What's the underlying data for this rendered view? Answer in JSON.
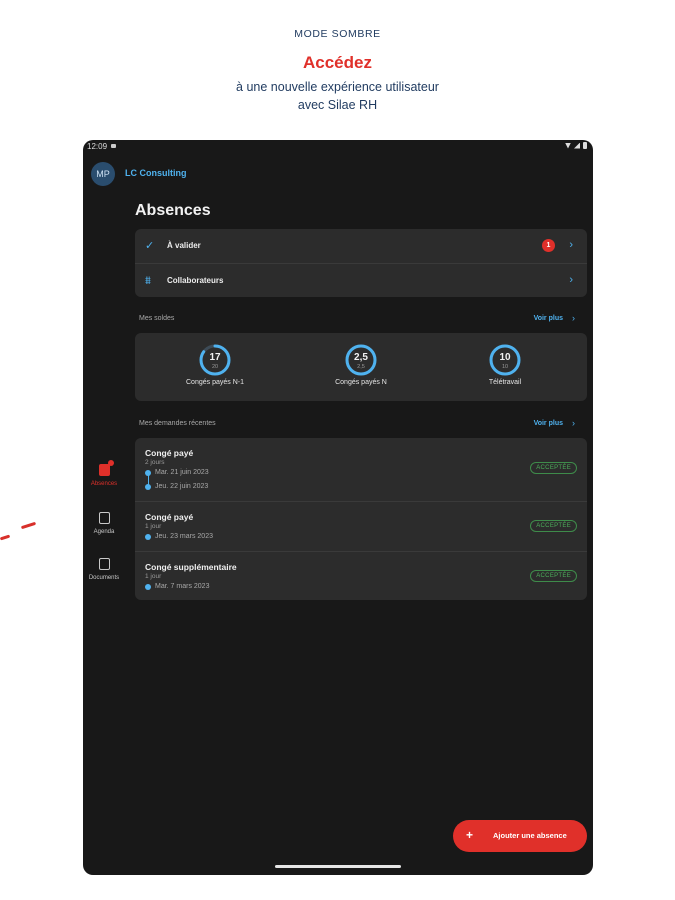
{
  "promo": {
    "mode_label": "MODE SOMBRE",
    "headline": "Accédez",
    "line1": "à une nouvelle expérience utilisateur",
    "line2": "avec Silae RH"
  },
  "statusbar": {
    "time": "12:09"
  },
  "app": {
    "avatar_initials": "MP",
    "company_name": "LC Consulting",
    "page_title": "Absences"
  },
  "colors": {
    "accent_blue": "#4fb2ef",
    "accent_red": "#e0302a",
    "background": "#181818",
    "card": "#2c2c2c",
    "status_green": "#4cae5a"
  },
  "quick_actions": [
    {
      "icon": "check-icon",
      "label": "À valider",
      "badge": "1"
    },
    {
      "icon": "team-icon",
      "label": "Collaborateurs"
    }
  ],
  "balances": {
    "section_title": "Mes soldes",
    "see_more": "Voir plus",
    "items": [
      {
        "value": "17",
        "total": "20",
        "label": "Congés payés N-1",
        "fraction": 0.85
      },
      {
        "value": "2,5",
        "total": "2,5",
        "label": "Congés payés N",
        "fraction": 1.0
      },
      {
        "value": "10",
        "total": "10",
        "label": "Télétravail",
        "fraction": 1.0
      }
    ]
  },
  "requests": {
    "section_title": "Mes demandes récentes",
    "see_more": "Voir plus",
    "items": [
      {
        "title": "Congé payé",
        "duration": "2 jours",
        "dates": [
          "Mar. 21 juin 2023",
          "Jeu. 22 juin 2023"
        ],
        "status": "ACCEPTÉE"
      },
      {
        "title": "Congé payé",
        "duration": "1 jour",
        "dates": [
          "Jeu. 23 mars 2023"
        ],
        "status": "ACCEPTÉE"
      },
      {
        "title": "Congé supplémentaire",
        "duration": "1 jour",
        "dates": [
          "Mar. 7 mars 2023"
        ],
        "status": "ACCEPTÉE"
      }
    ]
  },
  "nav": [
    {
      "label": "Absences",
      "icon": "absences-icon",
      "active": true
    },
    {
      "label": "Agenda",
      "icon": "calendar-icon",
      "active": false
    },
    {
      "label": "Documents",
      "icon": "document-icon",
      "active": false
    }
  ],
  "fab": {
    "label": "Ajouter une absence"
  }
}
